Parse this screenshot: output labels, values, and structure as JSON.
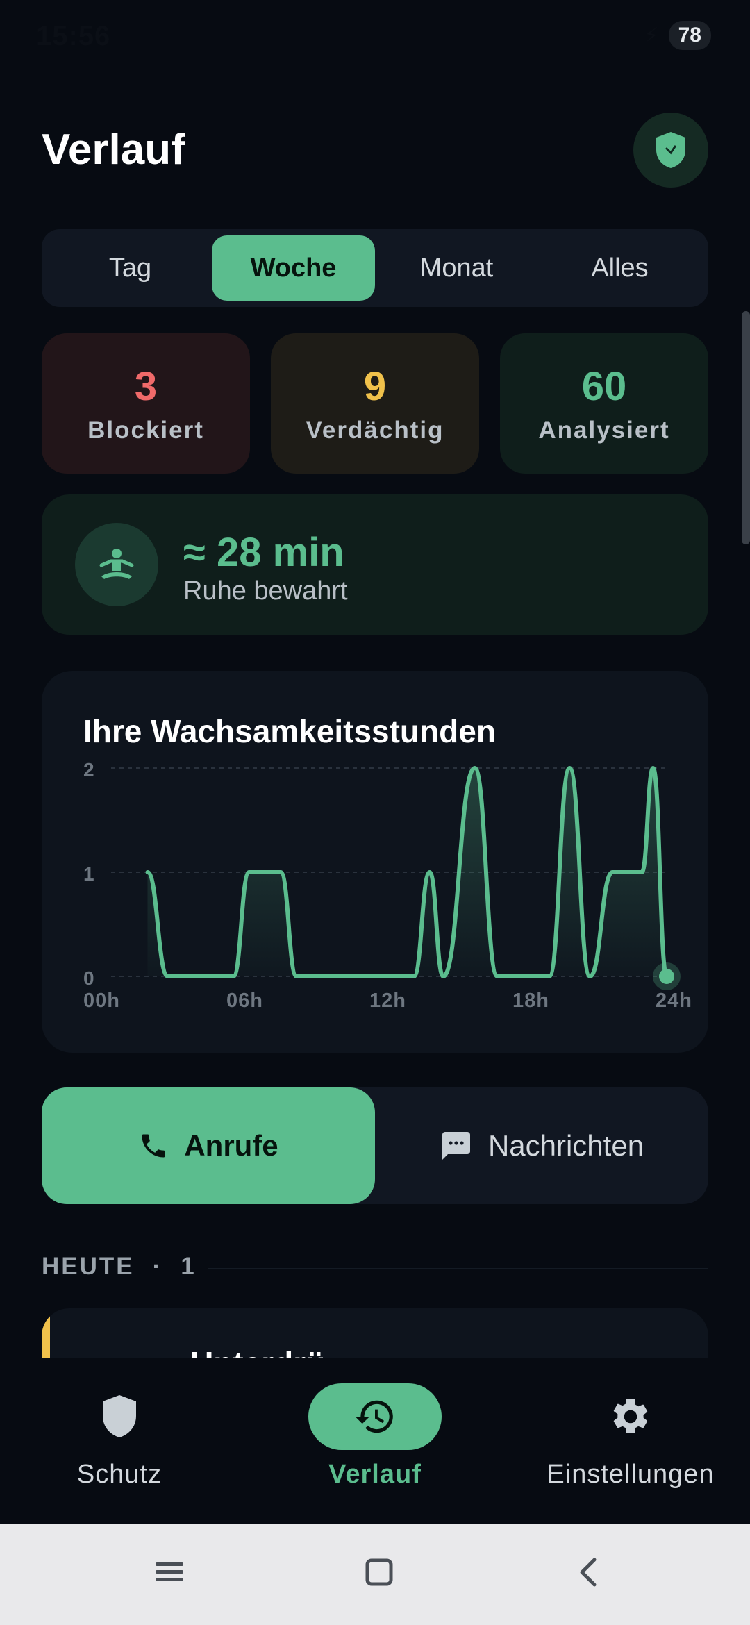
{
  "status": {
    "time": "15:56",
    "battery": "78"
  },
  "header": {
    "title": "Verlauf"
  },
  "range_tabs": {
    "items": [
      "Tag",
      "Woche",
      "Monat",
      "Alles"
    ],
    "selected": "Woche"
  },
  "stats": [
    {
      "value": "3",
      "label": "Blockiert",
      "color": "#f06a6a",
      "bg": "#221519"
    },
    {
      "value": "9",
      "label": "Verdächtig",
      "color": "#f0c14b",
      "bg": "#1e1c17"
    },
    {
      "value": "60",
      "label": "Analysiert",
      "color": "#5bbd8e",
      "bg": "#0f1e1b"
    }
  ],
  "calm": {
    "value": "≈ 28 min",
    "label": "Ruhe bewahrt"
  },
  "chart": {
    "title": "Ihre Wachsamkeitsstunden"
  },
  "chart_data": {
    "type": "area",
    "title": "Ihre Wachsamkeitsstunden",
    "xlabel": "",
    "ylabel": "",
    "x_ticks": [
      "00h",
      "06h",
      "12h",
      "18h",
      "24h"
    ],
    "y_ticks": [
      "0",
      "1",
      "2"
    ],
    "ylim": [
      0,
      2
    ],
    "xlim": [
      0,
      24
    ],
    "grid": true,
    "series": [
      {
        "color": "#5bbd8e",
        "points": [
          [
            1,
            1
          ],
          [
            1.9,
            0
          ],
          [
            4.8,
            0
          ],
          [
            5.5,
            1
          ],
          [
            6.9,
            1
          ],
          [
            7.6,
            0
          ],
          [
            12.8,
            0
          ],
          [
            13.5,
            1
          ],
          [
            14.1,
            0
          ],
          [
            15.5,
            2
          ],
          [
            16.5,
            0
          ],
          [
            18.8,
            0
          ],
          [
            19.7,
            2
          ],
          [
            20.6,
            0
          ],
          [
            21.6,
            1
          ],
          [
            22.9,
            1
          ],
          [
            23.4,
            2
          ],
          [
            24,
            0
          ]
        ]
      }
    ],
    "colors": {
      "line": "#5bbd8e"
    }
  },
  "list_tabs": {
    "calls": "Anrufe",
    "messages": "Nachrichten",
    "selected": "Anrufe"
  },
  "section": {
    "label": "HEUTE",
    "dot": "·",
    "count": "1"
  },
  "list": {
    "first_title": "Unterdrü"
  },
  "bottom_nav": [
    {
      "label": "Schutz",
      "icon": "shield-icon"
    },
    {
      "label": "Verlauf",
      "icon": "history-icon",
      "active": true
    },
    {
      "label": "Einstellungen",
      "icon": "gear-icon"
    }
  ],
  "colors": {
    "accent": "#5bbd8e",
    "background": "#070b12"
  }
}
